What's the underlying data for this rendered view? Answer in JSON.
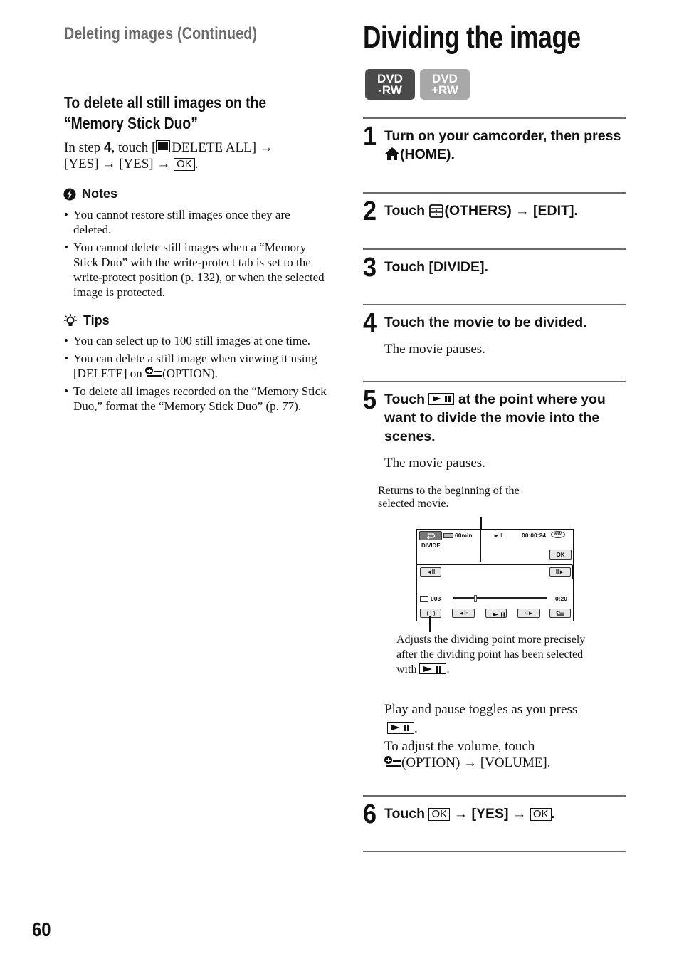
{
  "left_column": {
    "continued_title": "Deleting images (Continued)",
    "subsection_title": "To delete all still images on the “Memory Stick Duo”",
    "instruction": {
      "prefix": "In step ",
      "step_ref": "4",
      "middle": ", touch [",
      "delete_all": "DELETE ALL]",
      "arrow": "→",
      "yes1": "[YES]",
      "yes2": "[YES]",
      "ok": "OK",
      "end": "."
    },
    "notes": {
      "heading": "Notes",
      "icon": "notes-icon",
      "items": [
        "You cannot restore still images once they are deleted.",
        "You cannot delete still images when a “Memory Stick Duo” with the write-protect tab is set to the write-protect position (p. 132), or when the selected image is protected."
      ]
    },
    "tips": {
      "heading": "Tips",
      "icon": "lightbulb-icon",
      "items": [
        {
          "text": "You can select up to 100 still images at one time."
        },
        {
          "text_before": "You can delete a still image when viewing it using [DELETE] on ",
          "text_after": "(OPTION)."
        },
        {
          "text": "To delete all images recorded on the “Memory Stick Duo,” format the “Memory Stick Duo” (p. 77)."
        }
      ]
    }
  },
  "right_column": {
    "title": "Dividing the image",
    "badges": [
      {
        "line1": "DVD",
        "line2": "-RW",
        "active": true
      },
      {
        "line1": "DVD",
        "line2": "+RW",
        "active": false
      }
    ],
    "steps": [
      {
        "num": "1",
        "text_before": "Turn on your camcorder, then press ",
        "text_after": "(HOME)."
      },
      {
        "num": "2",
        "text_before": "Touch ",
        "text_after": "(OTHERS) → [EDIT]."
      },
      {
        "num": "3",
        "text": "Touch [DIVIDE]."
      },
      {
        "num": "4",
        "text": "Touch the movie to be divided.",
        "sub": "The movie pauses."
      },
      {
        "num": "5",
        "text_before": "Touch ",
        "text_after": " at the point where you want to divide the movie into the scenes.",
        "sub": "The movie pauses."
      },
      {
        "num": "6",
        "touch": "Touch ",
        "ok": "OK",
        "arrow": "→",
        "yes": "[YES]",
        "end": "."
      }
    ],
    "callouts": {
      "top": "Returns to the beginning of the selected movie.",
      "bottom_before": "Adjusts the dividing point more precisely after the dividing point has been selected with ",
      "bottom_after": "."
    },
    "screen": {
      "battery": "60min",
      "mode_label": "DIVIDE",
      "play_state": "►II",
      "timecode": "00:00:24",
      "disc": "RW",
      "ok_label": "OK",
      "prev_frame": "◄II",
      "next_frame": "II►",
      "scene_num": "003",
      "duration": "0:20",
      "progress_fraction": 0.22
    },
    "play_pause_note": {
      "text": "Play and pause toggles as you press",
      "end": "."
    },
    "volume_note": {
      "line1": "To adjust the volume, touch",
      "line2": "(OPTION) → [VOLUME]."
    }
  },
  "page_number": "60"
}
